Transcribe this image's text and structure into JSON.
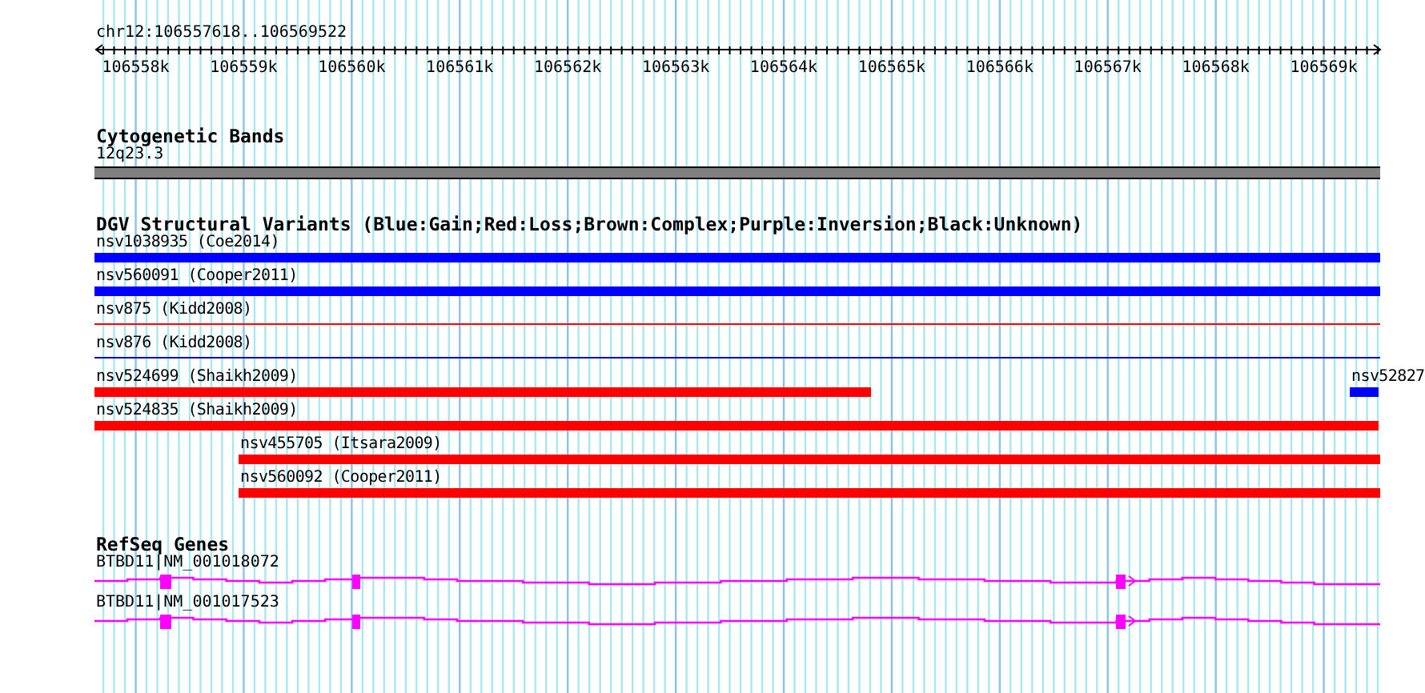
{
  "ruler": {
    "range": "chr12:106557618..106569522",
    "ticks": [
      "106558k",
      "106559k",
      "106560k",
      "106561k",
      "106562k",
      "106563k",
      "106564k",
      "106565k",
      "106566k",
      "106567k",
      "106568k",
      "106569k"
    ]
  },
  "cytogenetic_bands": {
    "title": "Cytogenetic Bands",
    "band": "12q23.3"
  },
  "structural_variants": {
    "title": "DGV Structural Variants (Blue:Gain;Red:Loss;Brown:Complex;Purple:Inversion;Black:Unknown)",
    "rows": [
      {
        "features": [
          {
            "label": "nsv1038935 (Coe2014)",
            "color": "#0000ff",
            "kind": "thick"
          }
        ]
      },
      {
        "features": [
          {
            "label": "nsv560091 (Cooper2011)",
            "color": "#0000ff",
            "kind": "thick"
          }
        ]
      },
      {
        "features": [
          {
            "label": "nsv875 (Kidd2008)",
            "color": "#ff0000",
            "kind": "thin"
          }
        ]
      },
      {
        "features": [
          {
            "label": "nsv876 (Kidd2008)",
            "color": "#0000cc",
            "kind": "thin"
          }
        ]
      },
      {
        "features": [
          {
            "label": "nsv524699 (Shaikh2009)",
            "color": "#ff0000",
            "kind": "thick"
          },
          {
            "label": "nsv52827",
            "color": "#0000ff",
            "kind": "thick"
          }
        ]
      },
      {
        "features": [
          {
            "label": "nsv524835 (Shaikh2009)",
            "color": "#ff0000",
            "kind": "thick"
          }
        ]
      },
      {
        "features": [
          {
            "label": "nsv455705 (Itsara2009)",
            "color": "#ff0000",
            "kind": "thick"
          }
        ]
      },
      {
        "features": [
          {
            "label": "nsv560092 (Cooper2011)",
            "color": "#ff0000",
            "kind": "thick"
          }
        ]
      }
    ]
  },
  "refseq_genes": {
    "title": "RefSeq Genes",
    "genes": [
      {
        "label": "BTBD11|NM_001018072"
      },
      {
        "label": "BTBD11|NM_001017523"
      }
    ]
  }
}
